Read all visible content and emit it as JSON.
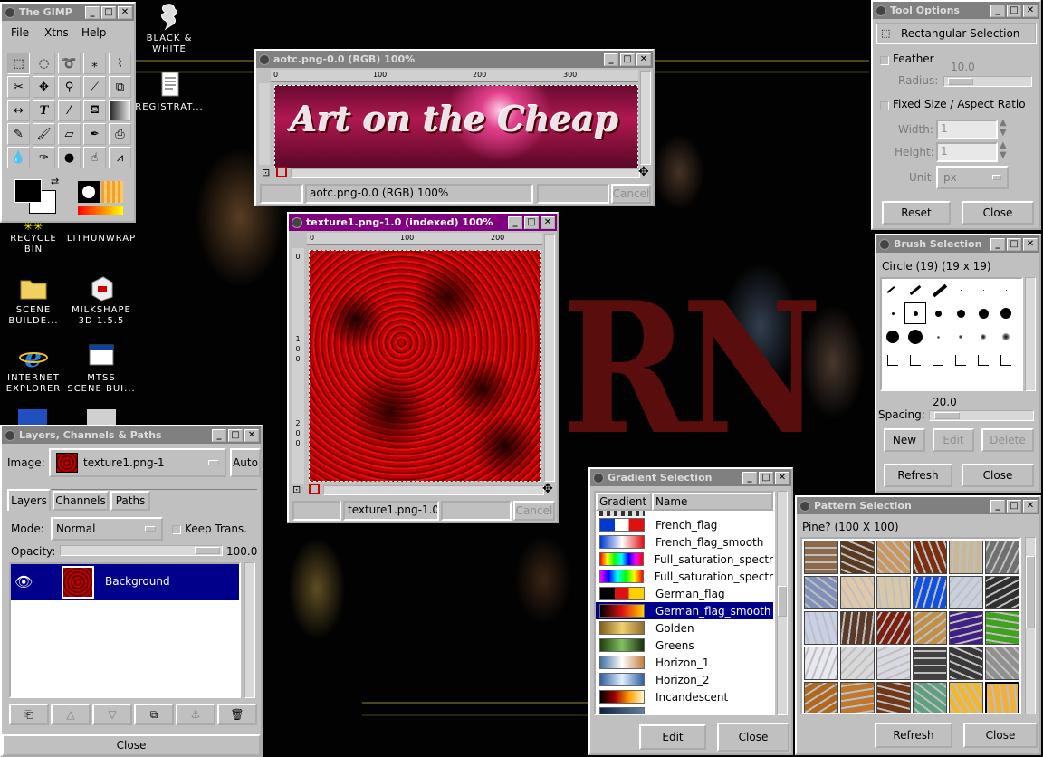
{
  "desktop": {
    "icons": [
      {
        "line1": "BLACK &",
        "line2": "WHITE"
      },
      {
        "line1": "REGISTRAT...",
        "line2": ""
      },
      {
        "line1": "RECYCLE",
        "line2": "BIN"
      },
      {
        "line1": "LITHUNWRAP",
        "line2": ""
      },
      {
        "line1": "SCENE",
        "line2": "BUILDE..."
      },
      {
        "line1": "MILKSHAPE",
        "line2": "3D 1.5.5"
      },
      {
        "line1": "INTERNET",
        "line2": "EXPLORER"
      },
      {
        "line1": "MTSS",
        "line2": "SCENE BUI..."
      }
    ]
  },
  "toolbox": {
    "title": "The GIMP",
    "menu": [
      "File",
      "Xtns",
      "Help"
    ]
  },
  "aotc": {
    "title": "aotc.png-0.0 (RGB) 100%",
    "banner": "Art on the Cheap",
    "status": "aotc.png-0.0 (RGB) 100%",
    "cancel": "Cancel",
    "ruler": [
      "0",
      "100",
      "200",
      "300"
    ]
  },
  "texture": {
    "title": "texture1.png-1.0 (indexed) 100%",
    "status": "texture1.png-1.0 (",
    "cancel": "Cancel",
    "ruler": [
      "0",
      "100",
      "200"
    ],
    "vruler": [
      "0",
      "1",
      "0",
      "0",
      "2",
      "0",
      "0"
    ]
  },
  "tool_options": {
    "title": "Tool Options",
    "tool": "Rectangular Selection",
    "feather": "Feather",
    "feather_value": "10.0",
    "radius": "Radius:",
    "fixed": "Fixed Size / Aspect Ratio",
    "width_label": "Width:",
    "width_value": "1",
    "height_label": "Height:",
    "height_value": "1",
    "unit_label": "Unit:",
    "unit_value": "px",
    "reset": "Reset",
    "close": "Close"
  },
  "brush": {
    "title": "Brush Selection",
    "name": "Circle (19)  (19 x 19)",
    "spacing_value": "20.0",
    "spacing": "Spacing:",
    "spacing_fraction": 0.06,
    "new": "New",
    "edit": "Edit",
    "delete": "Delete",
    "refresh": "Refresh",
    "close": "Close"
  },
  "layers": {
    "title": "Layers, Channels & Paths",
    "image_label": "Image:",
    "image_value": "texture1.png-1",
    "auto": "Auto",
    "tabs": [
      "Layers",
      "Channels",
      "Paths"
    ],
    "mode_label": "Mode:",
    "mode_value": "Normal",
    "keep": "Keep Trans.",
    "opacity_label": "Opacity:",
    "opacity_value": "100.0",
    "layer": "Background",
    "close": "Close"
  },
  "gradient": {
    "title": "Gradient Selection",
    "col1": "Gradient",
    "col2": "Name",
    "items": [
      "French_flag",
      "French_flag_smooth",
      "Full_saturation_spectr",
      "Full_saturation_spectr",
      "German_flag",
      "German_flag_smooth",
      "Golden",
      "Greens",
      "Horizon_1",
      "Horizon_2",
      "Incandescent"
    ],
    "selected": 5,
    "edit": "Edit",
    "close": "Close"
  },
  "pattern": {
    "title": "Pattern Selection",
    "name": "Pine?  (100 X 100)",
    "refresh": "Refresh",
    "close": "Close"
  }
}
